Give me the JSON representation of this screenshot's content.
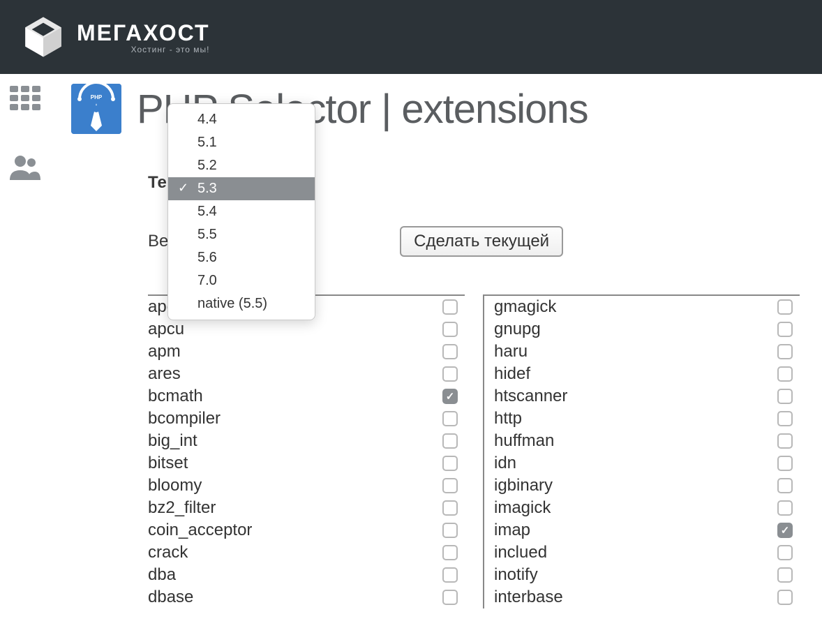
{
  "brand": {
    "name": "МЕГАХОСТ",
    "tagline": "Хостинг - это мы!"
  },
  "page_title": "PHP Selector | extensions",
  "labels": {
    "current_version": "Текущая ве",
    "php_version": "Версия PHP",
    "make_current": "Сделать текущей"
  },
  "dropdown": {
    "options": [
      "4.4",
      "5.1",
      "5.2",
      "5.3",
      "5.4",
      "5.5",
      "5.6",
      "7.0",
      "native (5.5)"
    ],
    "selected": "5.3"
  },
  "extensions_col1": [
    {
      "name": "apc",
      "checked": false
    },
    {
      "name": "apcu",
      "checked": false
    },
    {
      "name": "apm",
      "checked": false
    },
    {
      "name": "ares",
      "checked": false
    },
    {
      "name": "bcmath",
      "checked": true
    },
    {
      "name": "bcompiler",
      "checked": false
    },
    {
      "name": "big_int",
      "checked": false
    },
    {
      "name": "bitset",
      "checked": false
    },
    {
      "name": "bloomy",
      "checked": false
    },
    {
      "name": "bz2_filter",
      "checked": false
    },
    {
      "name": "coin_acceptor",
      "checked": false
    },
    {
      "name": "crack",
      "checked": false
    },
    {
      "name": "dba",
      "checked": false
    },
    {
      "name": "dbase",
      "checked": false
    }
  ],
  "extensions_col2": [
    {
      "name": "gmagick",
      "checked": false
    },
    {
      "name": "gnupg",
      "checked": false
    },
    {
      "name": "haru",
      "checked": false
    },
    {
      "name": "hidef",
      "checked": false
    },
    {
      "name": "htscanner",
      "checked": false
    },
    {
      "name": "http",
      "checked": false
    },
    {
      "name": "huffman",
      "checked": false
    },
    {
      "name": "idn",
      "checked": false
    },
    {
      "name": "igbinary",
      "checked": false
    },
    {
      "name": "imagick",
      "checked": false
    },
    {
      "name": "imap",
      "checked": true
    },
    {
      "name": "inclued",
      "checked": false
    },
    {
      "name": "inotify",
      "checked": false
    },
    {
      "name": "interbase",
      "checked": false
    }
  ]
}
